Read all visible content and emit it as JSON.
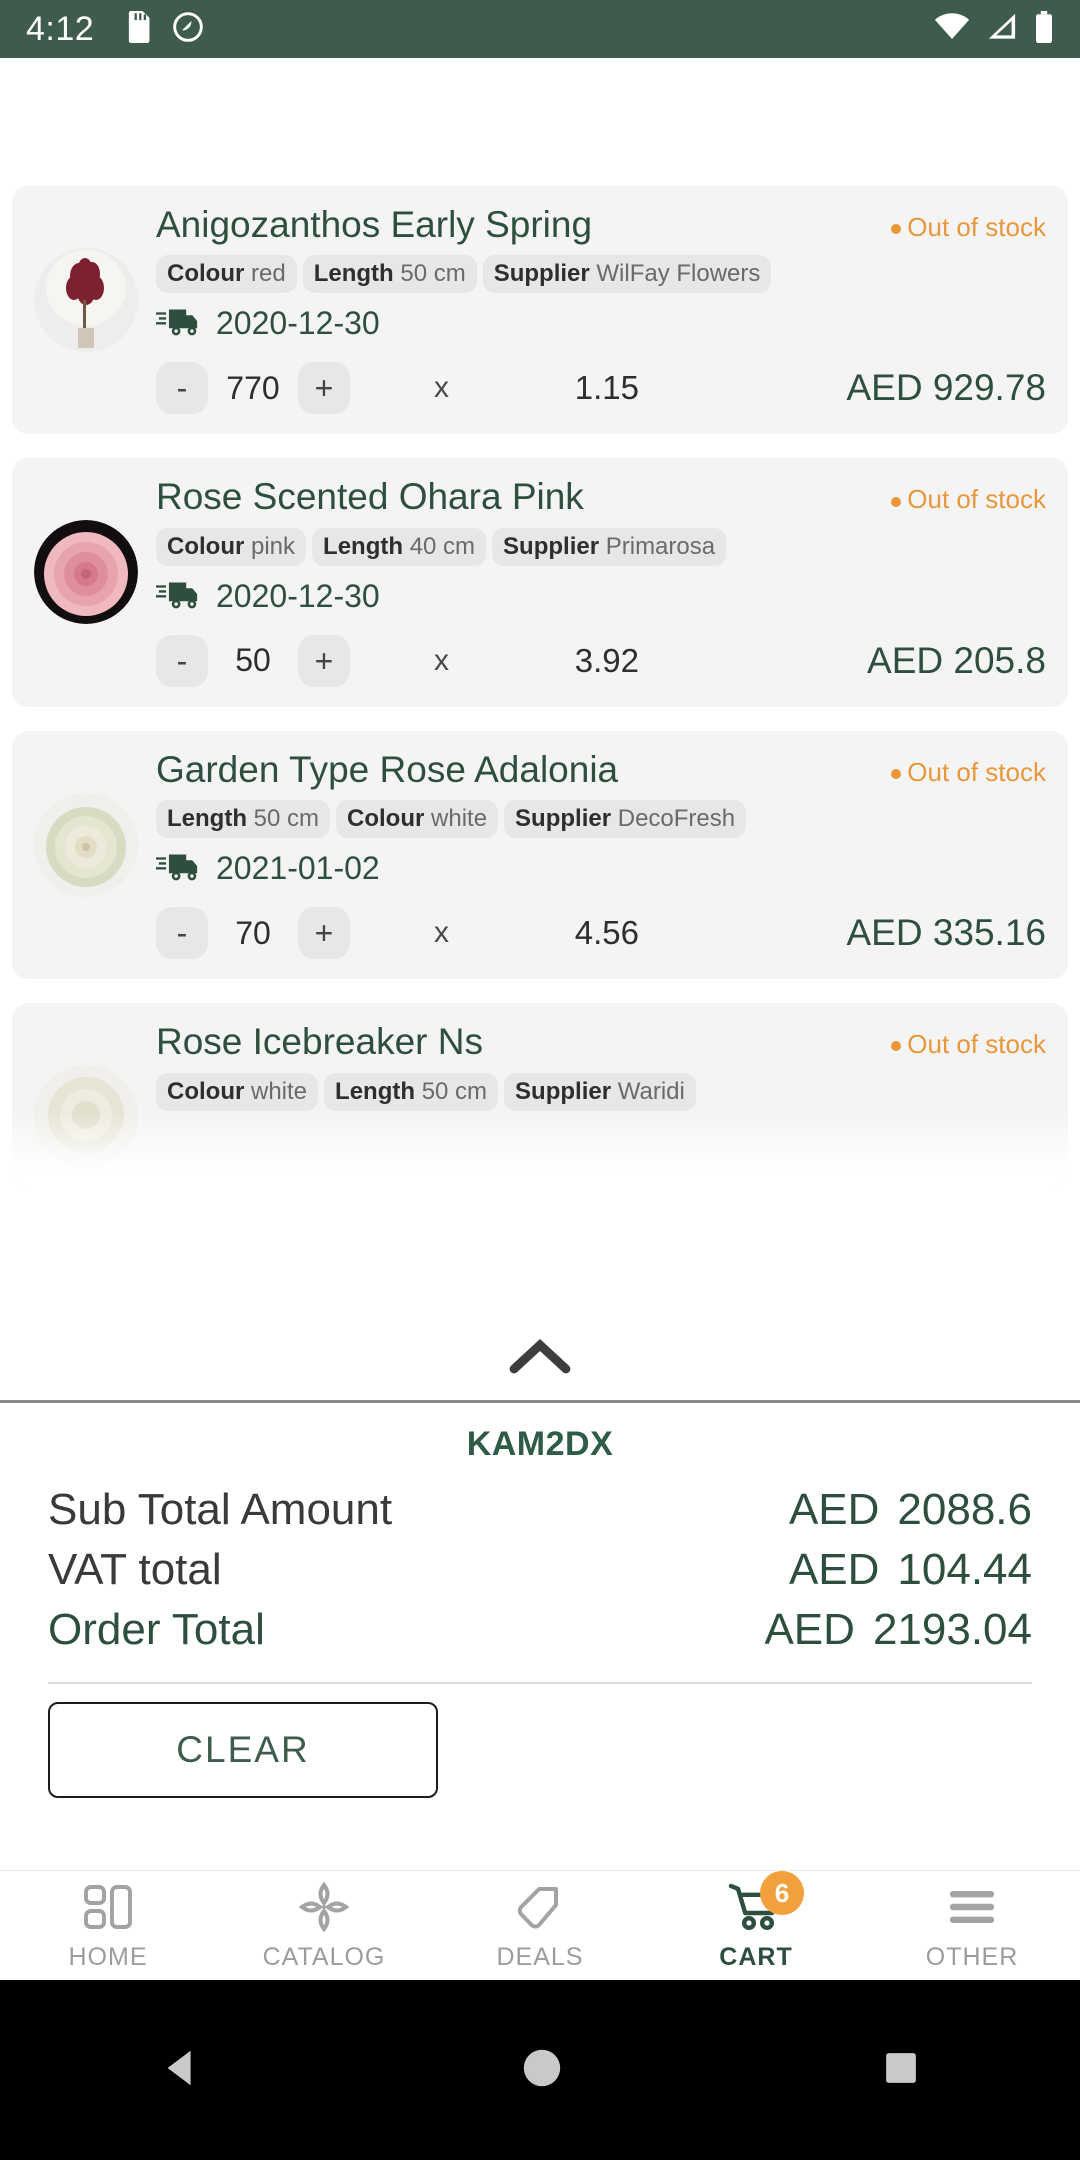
{
  "status_bar": {
    "time": "4:12",
    "icons": [
      "sd-card-icon",
      "do-not-disturb-icon"
    ],
    "right_icons": [
      "wifi-icon",
      "cellular-signal-icon",
      "battery-icon"
    ]
  },
  "cart": {
    "items": [
      {
        "title": "Anigozanthos Early Spring",
        "stock_status": "Out of stock",
        "chips": [
          {
            "label": "Colour",
            "value": "red"
          },
          {
            "label": "Length",
            "value": "50 cm"
          },
          {
            "label": "Supplier",
            "value": "WilFay Flowers"
          }
        ],
        "delivery_date": "2020-12-30",
        "decrement": "-",
        "increment": "+",
        "quantity": "770",
        "times": "x",
        "unit_price": "1.15",
        "line_total": "AED 929.78"
      },
      {
        "title": "Rose Scented Ohara Pink",
        "stock_status": "Out of stock",
        "chips": [
          {
            "label": "Colour",
            "value": "pink"
          },
          {
            "label": "Length",
            "value": "40 cm"
          },
          {
            "label": "Supplier",
            "value": "Primarosa"
          }
        ],
        "delivery_date": "2020-12-30",
        "decrement": "-",
        "increment": "+",
        "quantity": "50",
        "times": "x",
        "unit_price": "3.92",
        "line_total": "AED 205.8"
      },
      {
        "title": "Garden Type Rose Adalonia",
        "stock_status": "Out of stock",
        "chips": [
          {
            "label": "Length",
            "value": "50 cm"
          },
          {
            "label": "Colour",
            "value": "white"
          },
          {
            "label": "Supplier",
            "value": "DecoFresh"
          }
        ],
        "delivery_date": "2021-01-02",
        "decrement": "-",
        "increment": "+",
        "quantity": "70",
        "times": "x",
        "unit_price": "4.56",
        "line_total": "AED 335.16"
      },
      {
        "title": "Rose Icebreaker Ns",
        "stock_status": "Out of stock",
        "chips": [
          {
            "label": "Colour",
            "value": "white"
          },
          {
            "label": "Length",
            "value": "50 cm"
          },
          {
            "label": "Supplier",
            "value": "Waridi"
          }
        ]
      }
    ]
  },
  "summary": {
    "code": "KAM2DX",
    "rows": [
      {
        "label": "Sub Total Amount",
        "currency": "AED",
        "amount": "2088.6"
      },
      {
        "label": "VAT total",
        "currency": "AED",
        "amount": "104.44"
      },
      {
        "label": "Order Total",
        "currency": "AED",
        "amount": "2193.04"
      }
    ],
    "clear_label": "CLEAR"
  },
  "bottom_nav": {
    "items": [
      {
        "label": "HOME",
        "icon": "dashboard-grid-icon",
        "active": false
      },
      {
        "label": "CATALOG",
        "icon": "flower-icon",
        "active": false
      },
      {
        "label": "DEALS",
        "icon": "tag-icon",
        "active": false
      },
      {
        "label": "CART",
        "icon": "shopping-cart-icon",
        "active": true,
        "badge": "6"
      },
      {
        "label": "OTHER",
        "icon": "hamburger-menu-icon",
        "active": false
      }
    ]
  },
  "android_nav": {
    "back": "back-triangle-icon",
    "home": "home-circle-icon",
    "recents": "recents-square-icon"
  },
  "colors": {
    "brand_green": "#2f4f3e",
    "status_bar": "#3f5b4d",
    "accent_orange": "#e8973a",
    "card_bg": "#f4f4f4"
  }
}
